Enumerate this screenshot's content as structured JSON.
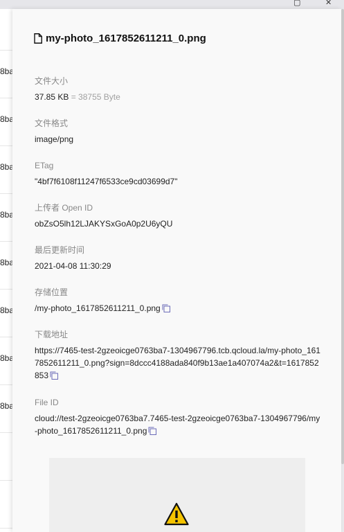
{
  "window": {
    "maximize_glyph": "▢",
    "close_glyph": "✕"
  },
  "background_table": {
    "row_fragments": [
      "8ba",
      "8ba",
      "8ba",
      "8ba",
      "8ba",
      "8ba",
      "8ba",
      "8ba"
    ]
  },
  "drawer": {
    "title": "my-photo_1617852611211_0.png",
    "title_icon": "file-icon",
    "fields": {
      "size": {
        "label": "文件大小",
        "value": "37.85 KB",
        "secondary": "= 38755 Byte"
      },
      "format": {
        "label": "文件格式",
        "value": "image/png"
      },
      "etag": {
        "label": "ETag",
        "value": "\"4bf7f6108f11247f6533ce9cd03699d7\""
      },
      "uploader": {
        "label": "上传者 Open ID",
        "value": "obZsO5lh12LJAKYSxGoA0p2U6yQU"
      },
      "updated": {
        "label": "最后更新时间",
        "value": "2021-04-08 11:30:29"
      },
      "location": {
        "label": "存储位置",
        "value": "/my-photo_1617852611211_0.png"
      },
      "download": {
        "label": "下载地址",
        "value": "https://7465-test-2gzeoicge0763ba7-1304967796.tcb.qcloud.la/my-photo_1617852611211_0.png?sign=8dccc4188ada840f9b13ae1a407074a2&t=1617852853"
      },
      "file_id": {
        "label": "File ID",
        "value": "cloud://test-2gzeoicge0763ba7.7465-test-2gzeoicge0763ba7-1304967796/my-photo_1617852611211_0.png"
      }
    },
    "preview": {
      "icon": "warning-icon",
      "icon_color": "#f5c400"
    }
  }
}
